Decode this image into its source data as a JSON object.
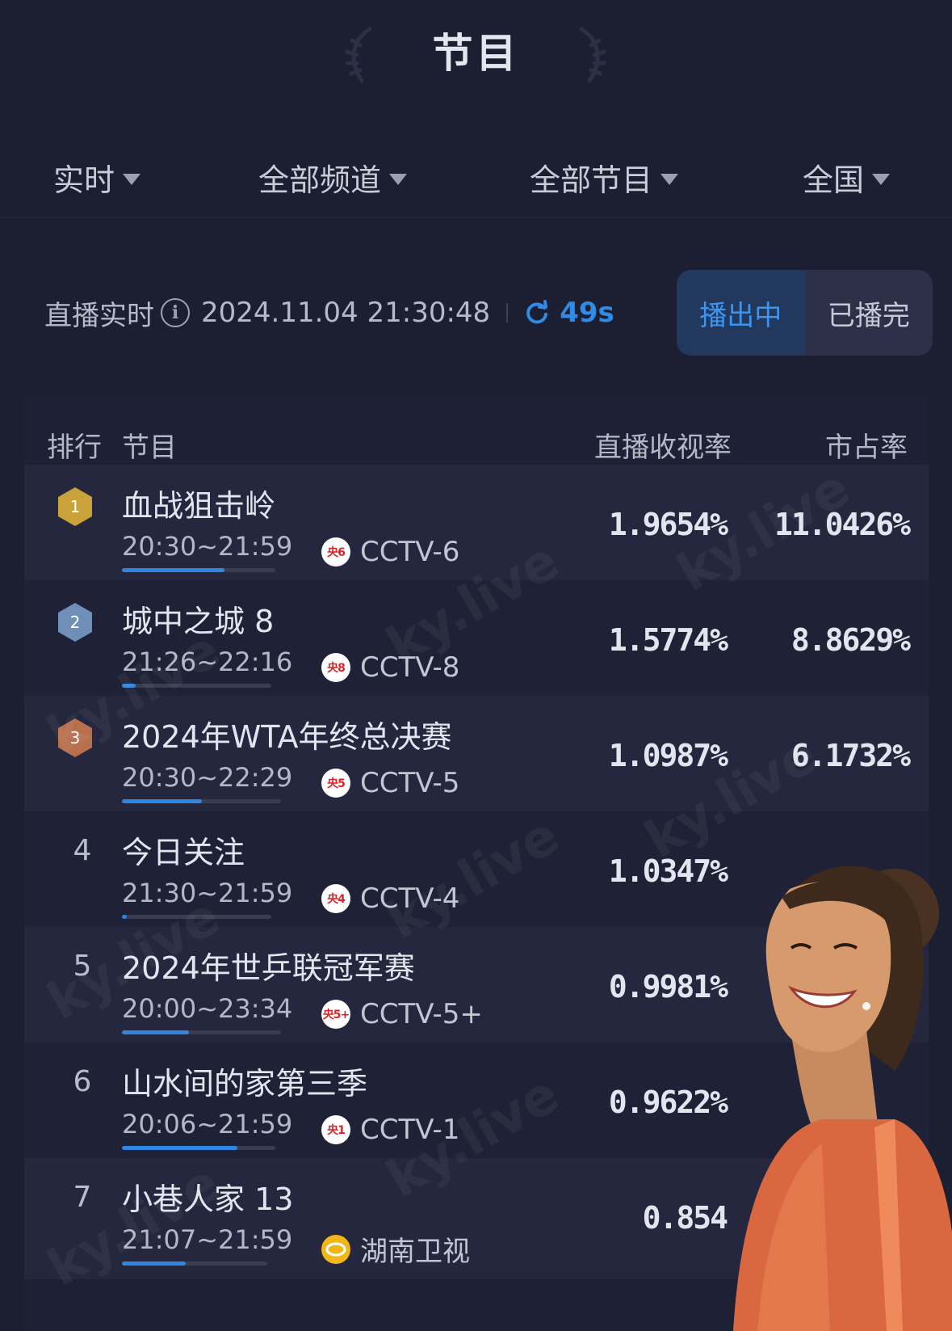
{
  "header": {
    "title": "节目"
  },
  "filters": [
    {
      "label": "实时"
    },
    {
      "label": "全部频道"
    },
    {
      "label": "全部节目"
    },
    {
      "label": "全国"
    }
  ],
  "live": {
    "label": "直播实时",
    "datetime": "2024.11.04 21:30:48",
    "refresh": "49s"
  },
  "toggle": {
    "on_air": "播出中",
    "finished": "已播完",
    "active": "on_air"
  },
  "table": {
    "headers": {
      "rank": "排行",
      "program": "节目",
      "rating": "直播收视率",
      "share": "市占率"
    },
    "rows": [
      {
        "rank": "1",
        "name": "血战狙击岭",
        "time": "20:30~21:59",
        "progress": 0.67,
        "channel_logo": "央6",
        "channel": "CCTV-6",
        "rating": "1.9654%",
        "share": "11.0426%"
      },
      {
        "rank": "2",
        "name": "城中之城 8",
        "time": "21:26~22:16",
        "progress": 0.09,
        "channel_logo": "央8",
        "channel": "CCTV-8",
        "rating": "1.5774%",
        "share": "8.8629%"
      },
      {
        "rank": "3",
        "name": "2024年WTA年终总决赛",
        "time": "20:30~22:29",
        "progress": 0.5,
        "channel_logo": "央5",
        "channel": "CCTV-5",
        "rating": "1.0987%",
        "share": "6.1732%"
      },
      {
        "rank": "4",
        "name": "今日关注",
        "time": "21:30~21:59",
        "progress": 0.03,
        "channel_logo": "央4",
        "channel": "CCTV-4",
        "rating": "1.0347%",
        "share": ""
      },
      {
        "rank": "5",
        "name": "2024年世乒联冠军赛",
        "time": "20:00~23:34",
        "progress": 0.42,
        "channel_logo": "央5+",
        "channel": "CCTV-5+",
        "rating": "0.9981%",
        "share": ""
      },
      {
        "rank": "6",
        "name": "山水间的家第三季",
        "time": "20:06~21:59",
        "progress": 0.75,
        "channel_logo": "央1",
        "channel": "CCTV-1",
        "rating": "0.9622%",
        "share": ""
      },
      {
        "rank": "7",
        "name": "小巷人家 13",
        "time": "21:07~21:59",
        "progress": 0.44,
        "channel_logo": "",
        "channel": "湖南卫视",
        "rating": "0.854",
        "share": ""
      }
    ]
  },
  "watermark": "ky.live",
  "colors": {
    "background": "#1c1e31",
    "accent": "#2e8be6",
    "gold": "#c9a23a",
    "silver": "#6f8fb8",
    "bronze": "#b86f4c"
  }
}
